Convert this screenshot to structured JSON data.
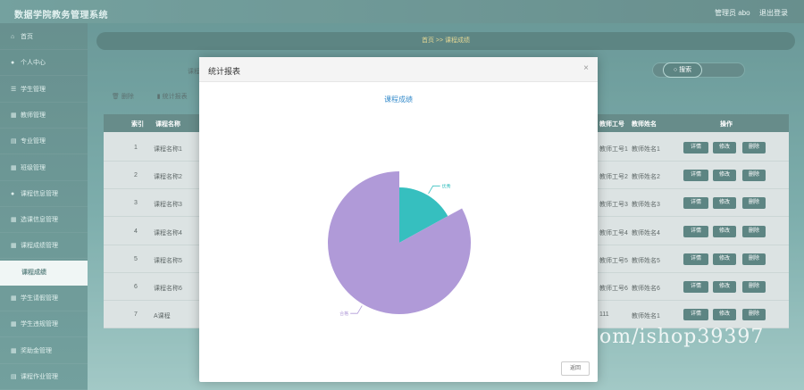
{
  "app": {
    "title": "数据学院教务管理系统",
    "admin": "管理员 abo",
    "logout": "退出登录"
  },
  "sidebar": {
    "items": [
      {
        "label": "首页",
        "icon": "home-icon",
        "glyph": "⌂"
      },
      {
        "label": "个人中心",
        "icon": "user-icon",
        "glyph": "●"
      },
      {
        "label": "学生管理",
        "icon": "student-icon",
        "glyph": "☰"
      },
      {
        "label": "教师管理",
        "icon": "grid-icon",
        "glyph": "▦"
      },
      {
        "label": "专业管理",
        "icon": "grid-icon",
        "glyph": "▤"
      },
      {
        "label": "班级管理",
        "icon": "grid-icon",
        "glyph": "▦"
      },
      {
        "label": "课程信息管理",
        "icon": "user-icon",
        "glyph": "●"
      },
      {
        "label": "选课信息管理",
        "icon": "grid-icon",
        "glyph": "▦"
      },
      {
        "label": "课程成绩管理",
        "icon": "grid-icon",
        "glyph": "▦"
      },
      {
        "label": "课程成绩",
        "icon": "",
        "glyph": ""
      },
      {
        "label": "学生请假管理",
        "icon": "grid-icon",
        "glyph": "▦"
      },
      {
        "label": "学生违规管理",
        "icon": "grid-icon",
        "glyph": "▦"
      },
      {
        "label": "奖助金管理",
        "icon": "grid-icon",
        "glyph": "▦"
      },
      {
        "label": "课程作业管理",
        "icon": "doc-icon",
        "glyph": "▤"
      }
    ]
  },
  "breadcrumb": "首页  >>  课程成绩",
  "search": {
    "label": "课程",
    "button": "搜索",
    "button_icon": "○"
  },
  "toolbar": {
    "delete": "删除",
    "stats": "统计报表"
  },
  "table": {
    "headers": [
      "",
      "索引",
      "课程名称",
      "",
      "",
      "",
      "",
      "",
      "",
      "",
      "",
      "",
      "",
      "教师工号",
      "教师姓名",
      "操作"
    ],
    "rows": [
      {
        "index": "1",
        "course": "课程名称1",
        "teacher_id": "教师工号1",
        "teacher_name": "教师姓名1"
      },
      {
        "index": "2",
        "course": "课程名称2",
        "teacher_id": "教师工号2",
        "teacher_name": "教师姓名2"
      },
      {
        "index": "3",
        "course": "课程名称3",
        "teacher_id": "教师工号3",
        "teacher_name": "教师姓名3"
      },
      {
        "index": "4",
        "course": "课程名称4",
        "teacher_id": "教师工号4",
        "teacher_name": "教师姓名4"
      },
      {
        "index": "5",
        "course": "课程名称5",
        "teacher_id": "教师工号5",
        "teacher_name": "教师姓名5"
      },
      {
        "index": "6",
        "course": "课程名称6",
        "teacher_id": "教师工号6",
        "teacher_name": "教师姓名6"
      },
      {
        "index": "7",
        "course": "A课程",
        "teacher_id": "111",
        "teacher_name": "教师姓名1"
      }
    ],
    "actions": [
      "详情",
      "修改",
      "删除"
    ]
  },
  "modal": {
    "title": "统计报表",
    "close": "×",
    "back": "返回"
  },
  "chart_data": {
    "type": "pie",
    "title": "课程成绩",
    "slices": [
      {
        "label": "优秀",
        "value": 17,
        "color": "#36bfbf"
      },
      {
        "label": "合格",
        "value": 83,
        "color": "#b09ad8"
      }
    ],
    "legend": false
  },
  "watermark": "https://www.huzhan.com/ishop39397"
}
